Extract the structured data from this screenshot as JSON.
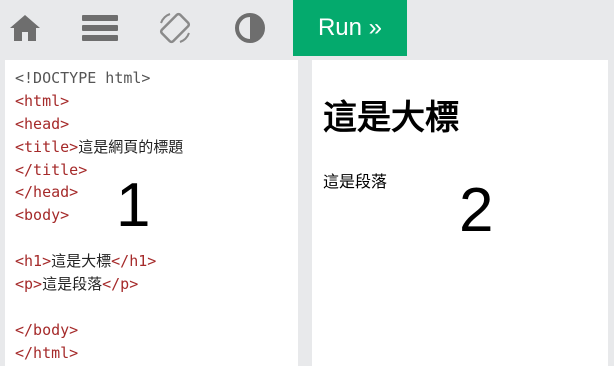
{
  "toolbar": {
    "icons": [
      "home-icon",
      "menu-icon",
      "rotate-icon",
      "contrast-icon"
    ],
    "run_label": "Run »",
    "run_color": "#04aa6d"
  },
  "code": {
    "doctype": "<!DOCTYPE html>",
    "html_open": "<html>",
    "head_open": "<head>",
    "title_open": "<title>",
    "title_text": "這是網頁的標題",
    "title_close": "</title>",
    "head_close": "</head>",
    "body_open": "<body>",
    "h1_open": "<h1>",
    "h1_text": "這是大標",
    "h1_close": "</h1>",
    "p_open": "<p>",
    "p_text": "這是段落",
    "p_close": "</p>",
    "body_close": "</body>",
    "html_close": "</html>",
    "tag_color": "#a52a2a"
  },
  "annotations": {
    "code_panel_number": "1",
    "result_panel_number": "2"
  },
  "result": {
    "heading": "這是大標",
    "paragraph": "這是段落"
  }
}
